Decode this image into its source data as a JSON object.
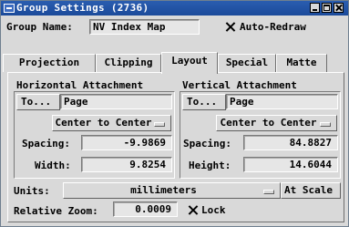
{
  "window": {
    "title": "Group Settings (2736)"
  },
  "group_name": {
    "label": "Group Name:",
    "value": "NV Index Map"
  },
  "auto_redraw": {
    "label": "Auto-Redraw",
    "checked": true
  },
  "tabs": [
    {
      "label": "Projection",
      "active": false
    },
    {
      "label": "Clipping",
      "active": false
    },
    {
      "label": "Layout",
      "active": true
    },
    {
      "label": "Special",
      "active": false
    },
    {
      "label": "Matte",
      "active": false
    }
  ],
  "horizontal": {
    "heading": "Horizontal Attachment",
    "to_button": "To...",
    "to_value": "Page",
    "mode": "Center to Center",
    "spacing_label": "Spacing:",
    "spacing_value": "-9.9869",
    "width_label": "Width:",
    "width_value": "9.8254"
  },
  "vertical": {
    "heading": "Vertical Attachment",
    "to_button": "To...",
    "to_value": "Page",
    "mode": "Center to Center",
    "spacing_label": "Spacing:",
    "spacing_value": "84.8827",
    "height_label": "Height:",
    "height_value": "14.6044"
  },
  "units": {
    "label": "Units:",
    "value": "millimeters",
    "at_scale": "At Scale"
  },
  "relative_zoom": {
    "label": "Relative Zoom:",
    "value": "0.0009",
    "lock_label": "Lock",
    "lock_checked": true
  }
}
